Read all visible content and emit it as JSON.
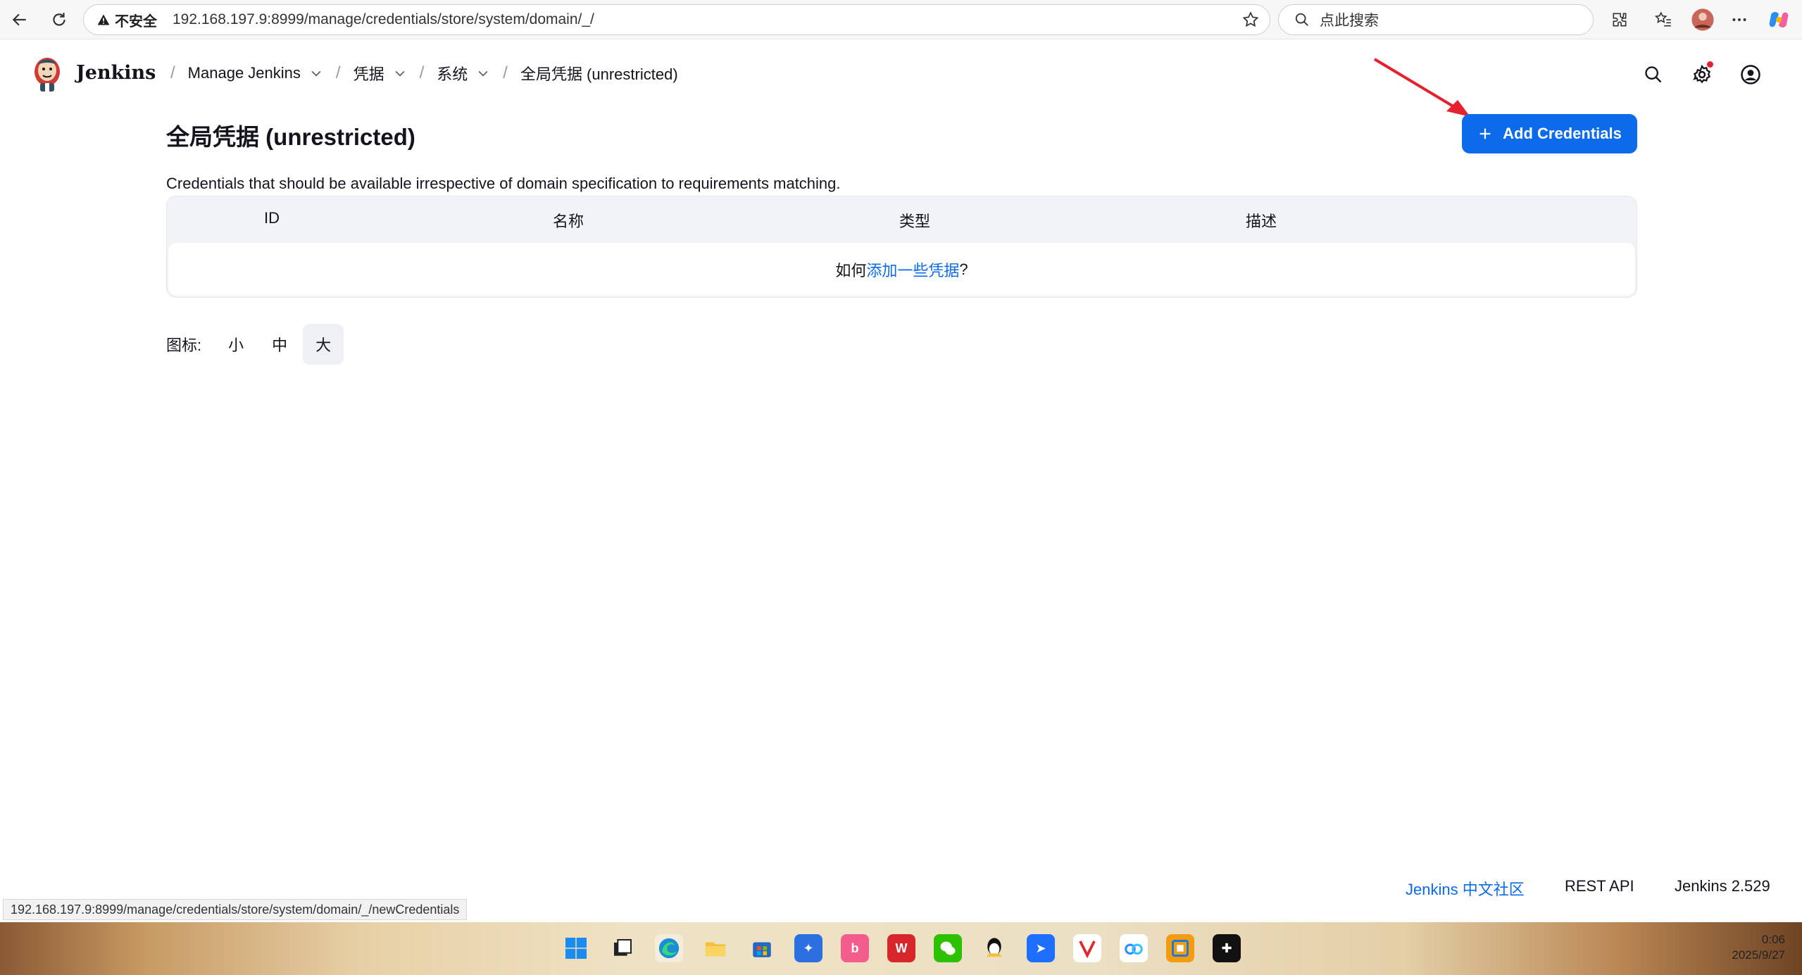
{
  "browser": {
    "insecure_label": "不安全",
    "url": "192.168.197.9:8999/manage/credentials/store/system/domain/_/",
    "search_placeholder": "点此搜索"
  },
  "header": {
    "brand": "Jenkins",
    "breadcrumbs": [
      {
        "label": "Manage Jenkins"
      },
      {
        "label": "凭据"
      },
      {
        "label": "系统"
      },
      {
        "label": "全局凭据 (unrestricted)"
      }
    ]
  },
  "main": {
    "title": "全局凭据 (unrestricted)",
    "add_button": "Add Credentials",
    "description": "Credentials that should be available irrespective of domain specification to requirements matching.",
    "table": {
      "columns": [
        "ID",
        "名称",
        "类型",
        "描述"
      ],
      "empty_prefix": "如何",
      "empty_link": "添加一些凭据",
      "empty_suffix": "?"
    },
    "icon_size": {
      "label": "图标:",
      "options": [
        "小",
        "中",
        "大"
      ],
      "selected": "大"
    }
  },
  "footer": {
    "community": "Jenkins 中文社区",
    "rest_api": "REST API",
    "version": "Jenkins 2.529"
  },
  "status_bar_url": "192.168.197.9:8999/manage/credentials/store/system/domain/_/newCredentials",
  "taskbar": {
    "time": "0:06",
    "date": "2025/9/27"
  },
  "colors": {
    "accent": "#0b6bea",
    "arrow": "#e5212f"
  }
}
